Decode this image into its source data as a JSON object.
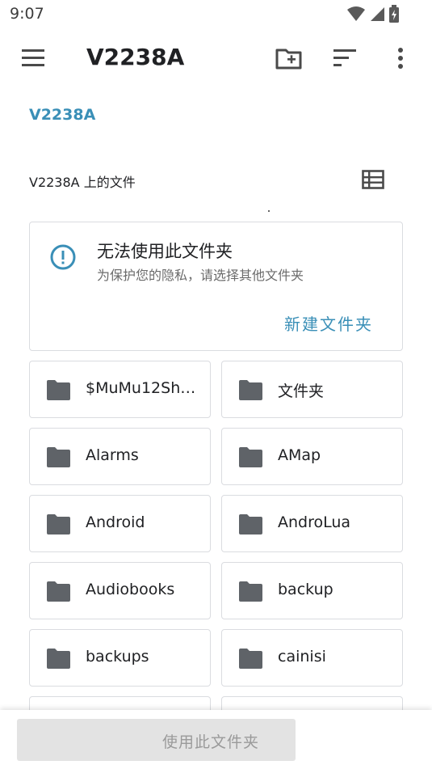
{
  "status_bar": {
    "time": "9:07",
    "icons": [
      "wifi-icon",
      "signal-icon",
      "battery-charging-icon"
    ]
  },
  "app_bar": {
    "title": "V2238A",
    "actions": [
      "menu-icon",
      "new-folder-icon",
      "sort-icon",
      "more-vert-icon"
    ]
  },
  "breadcrumb": {
    "current": "V2238A"
  },
  "section": {
    "header": "V2238A 上的文件",
    "view_toggle_icon": "list-view-icon"
  },
  "info_card": {
    "icon": "info-icon",
    "title": "无法使用此文件夹",
    "subtitle": "为保护您的隐私，请选择其他文件夹",
    "action": "新建文件夹"
  },
  "folders": [
    {
      "name": "$MuMu12Sh…"
    },
    {
      "name": "文件夹"
    },
    {
      "name": "Alarms"
    },
    {
      "name": "AMap"
    },
    {
      "name": "Android"
    },
    {
      "name": "AndroLua"
    },
    {
      "name": "Audiobooks"
    },
    {
      "name": "backup"
    },
    {
      "name": "backups"
    },
    {
      "name": "cainisi"
    }
  ],
  "bottom_bar": {
    "use_button": "使用此文件夹"
  },
  "colors": {
    "accent": "#3a8fb7",
    "icon_gray": "#5f6368",
    "border": "#dadce0",
    "disabled_button": "#e3e3e3"
  }
}
